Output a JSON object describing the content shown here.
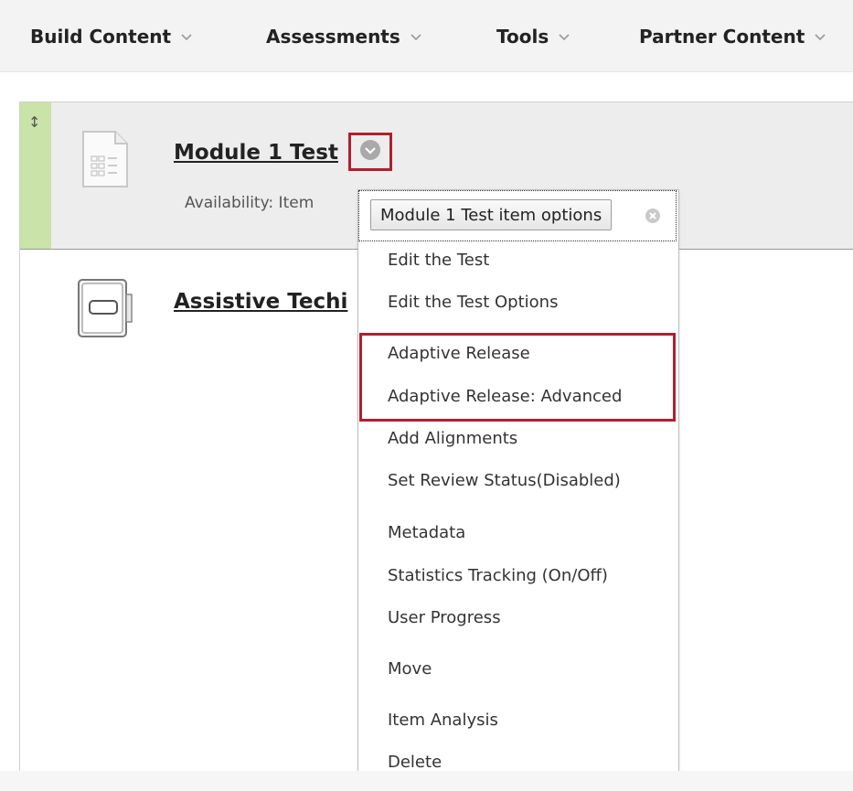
{
  "toolbar": {
    "items": [
      {
        "label": "Build Content",
        "icon": "chevron-down-icon"
      },
      {
        "label": "Assessments",
        "icon": "chevron-down-icon"
      },
      {
        "label": "Tools",
        "icon": "chevron-down-icon"
      },
      {
        "label": "Partner Content",
        "icon": "chevron-down-icon"
      }
    ]
  },
  "items": [
    {
      "title": "Module 1 Test",
      "availability": "Availability:  Item",
      "icon": "test-document-icon",
      "drag_handle_icon": "drag-arrows-icon",
      "selected_color": "#c9e3a8"
    },
    {
      "title": "Assistive Techi",
      "icon": "notebook-icon"
    }
  ],
  "menu": {
    "header_button": "Module 1 Test item options",
    "close_icon": "close-circle-icon",
    "items": [
      "Edit the Test",
      "Edit the Test Options",
      "Adaptive Release",
      "Adaptive Release: Advanced",
      "Add Alignments",
      "Set Review Status(Disabled)",
      "Metadata",
      "Statistics Tracking (On/Off)",
      "User Progress",
      "Move",
      "Item Analysis",
      "Delete"
    ]
  },
  "colors": {
    "highlight": "#b01f2e",
    "selected_row": "#ededed",
    "drag_bar": "#c9e3a8"
  }
}
